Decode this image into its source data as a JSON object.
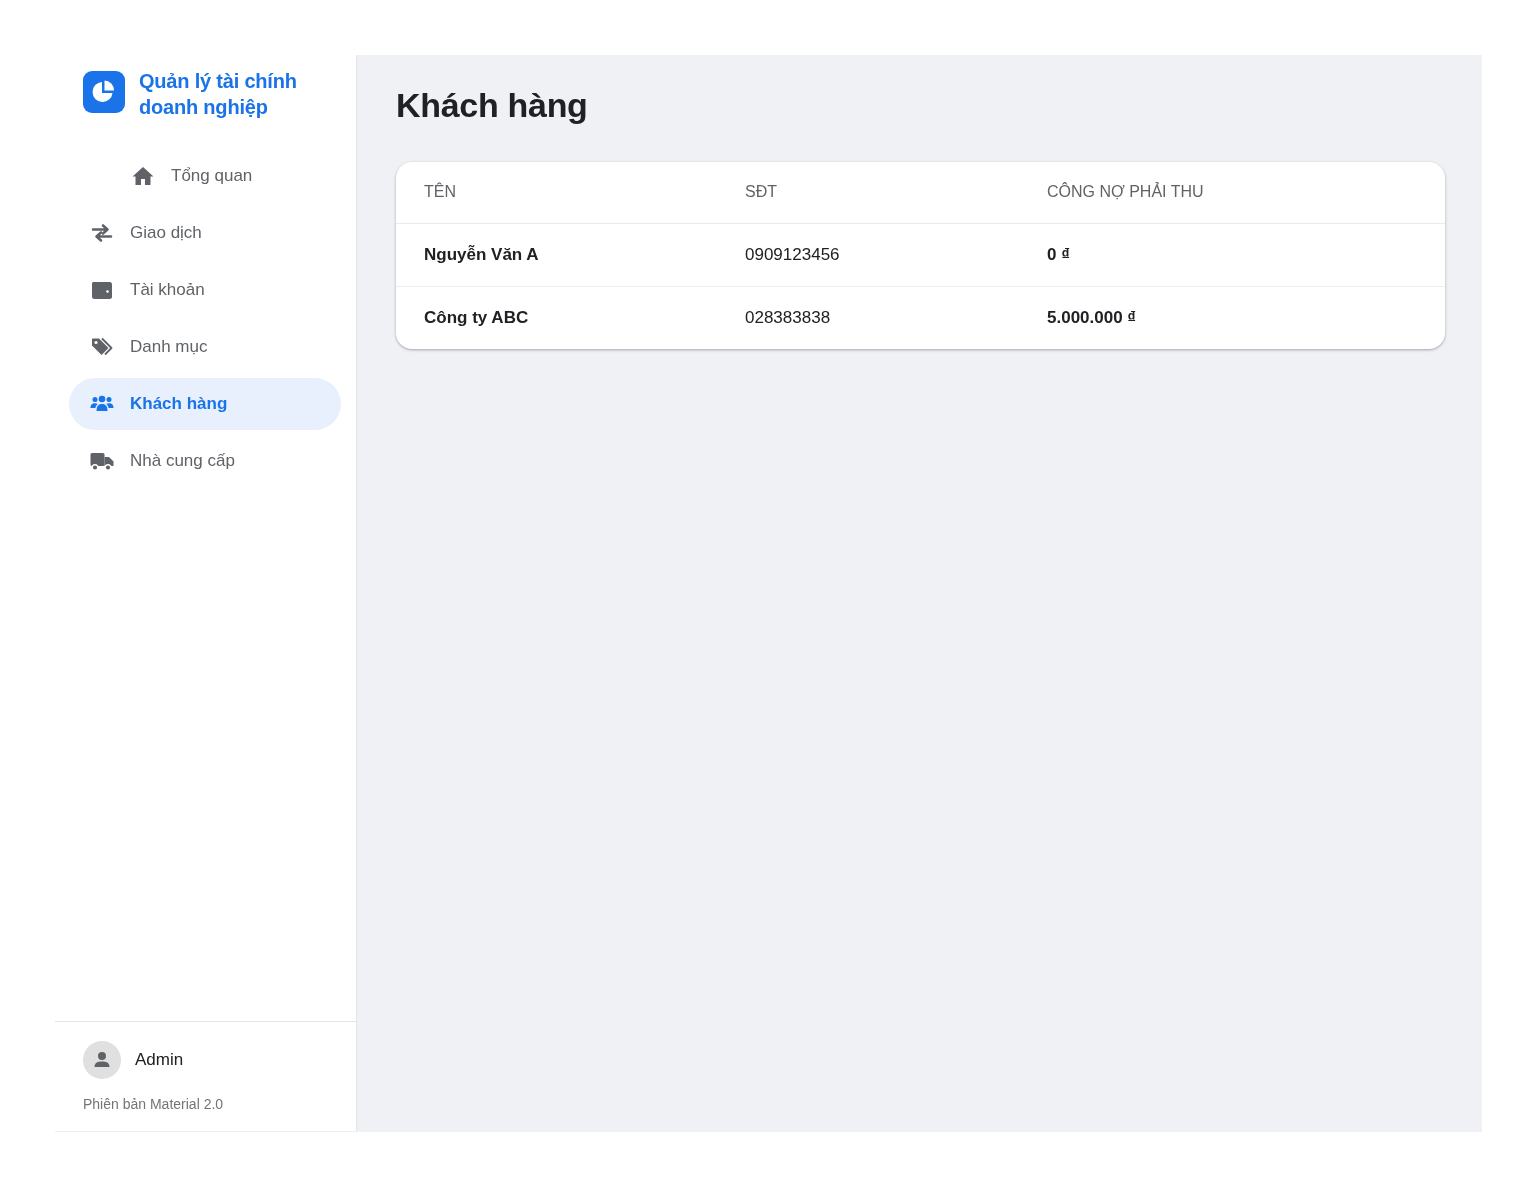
{
  "sidebar": {
    "app_title": "Quản lý tài chính doanh nghiệp",
    "items": [
      {
        "label": "Tổng quan",
        "selected": false
      },
      {
        "label": "Giao dịch",
        "selected": false
      },
      {
        "label": "Tài khoản",
        "selected": false
      },
      {
        "label": "Danh mục",
        "selected": false
      },
      {
        "label": "Khách hàng",
        "selected": true
      },
      {
        "label": "Nhà cung cấp",
        "selected": false
      }
    ],
    "user": {
      "name": "Admin",
      "version": "Phiên bản Material 2.0"
    }
  },
  "page": {
    "title": "Khách hàng"
  },
  "table": {
    "columns": [
      "TÊN",
      "SĐT",
      "CÔNG NỢ PHẢI THU"
    ],
    "rows": [
      [
        "Nguyễn Văn A",
        "0909123456",
        "0 ₫"
      ],
      [
        "Công ty ABC",
        "028383838",
        "5.000.000 ₫"
      ]
    ]
  }
}
